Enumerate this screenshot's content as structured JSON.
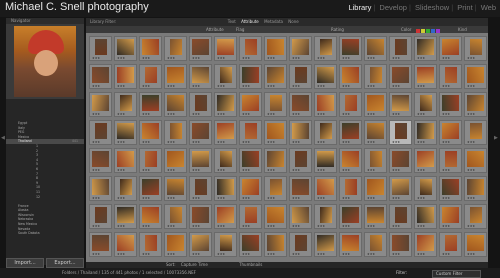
{
  "header": {
    "title": "Michael C. Snell photography",
    "modules": [
      "Library",
      "Develop",
      "Slideshow",
      "Print",
      "Web"
    ],
    "active_module": "Library"
  },
  "navigator": {
    "label": "Navigator"
  },
  "folders": [
    {
      "label": "Egypt",
      "count": "",
      "sub": false
    },
    {
      "label": "Italy",
      "count": "",
      "sub": false
    },
    {
      "label": "PEG",
      "count": "",
      "sub": false
    },
    {
      "label": "Mexico",
      "count": "",
      "sub": false
    },
    {
      "label": "Thailand",
      "count": "441",
      "sub": false,
      "selected": true
    },
    {
      "label": "1",
      "count": "",
      "sub": true
    },
    {
      "label": "2",
      "count": "",
      "sub": true
    },
    {
      "label": "3",
      "count": "",
      "sub": true
    },
    {
      "label": "4",
      "count": "",
      "sub": true
    },
    {
      "label": "5",
      "count": "",
      "sub": true
    },
    {
      "label": "6",
      "count": "",
      "sub": true
    },
    {
      "label": "7",
      "count": "",
      "sub": true
    },
    {
      "label": "8",
      "count": "",
      "sub": true
    },
    {
      "label": "9",
      "count": "",
      "sub": true
    },
    {
      "label": "10",
      "count": "",
      "sub": true
    },
    {
      "label": "11",
      "count": "",
      "sub": true
    },
    {
      "label": "12",
      "count": "",
      "sub": true
    },
    {
      "label": "",
      "count": "",
      "sub": false
    },
    {
      "label": "France",
      "count": "",
      "sub": false
    },
    {
      "label": "Alaska",
      "count": "",
      "sub": false
    },
    {
      "label": "Wisconsin",
      "count": "",
      "sub": false
    },
    {
      "label": "Nebraska",
      "count": "",
      "sub": false
    },
    {
      "label": "New Mexico",
      "count": "",
      "sub": false
    },
    {
      "label": "Nevada",
      "count": "",
      "sub": false
    },
    {
      "label": "South Dakota",
      "count": "",
      "sub": false
    }
  ],
  "left_buttons": {
    "import": "Import...",
    "export": "Export..."
  },
  "filterbar": {
    "label": "Library Filter:",
    "items": [
      "Text",
      "Attribute",
      "Metadata",
      "None"
    ],
    "active": "Attribute"
  },
  "metabar": {
    "attribute_label": "Attribute",
    "flag_label": "Flag",
    "rating_label": "Rating",
    "color_label": "Color",
    "kind_label": "Kind"
  },
  "grid": {
    "columns": 16,
    "rows": 8,
    "selected_index": 60,
    "palette": [
      "#6b3a1f",
      "#a0561e",
      "#c9852f",
      "#3f2a1b",
      "#8a4b2a",
      "#5c4432",
      "#b36a33",
      "#2f2a24",
      "#d39b4a",
      "#7a5230",
      "#3c3f2a",
      "#9b3f24"
    ]
  },
  "bottom_toolbar": {
    "sort_label": "Sort:",
    "sort_value": "Capture Time",
    "thumbnails_label": "Thumbnails"
  },
  "status": {
    "path": "Folders / Thailand / 135 of 441 photos / 1 selected / 10073356.NEF",
    "filter_label": "Filter:",
    "filter_value": "Custom Filter"
  }
}
